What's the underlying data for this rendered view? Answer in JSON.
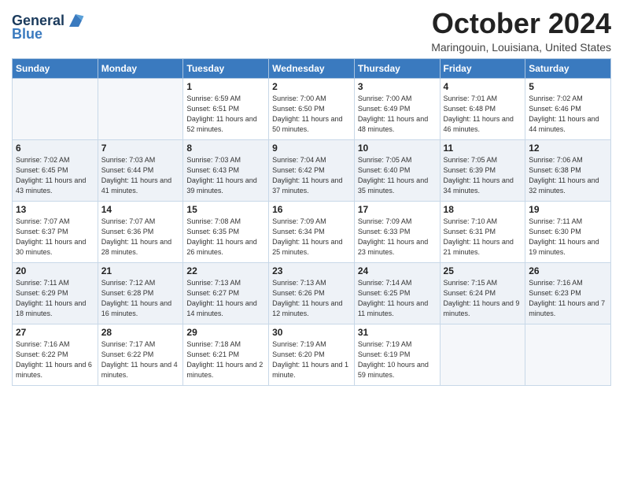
{
  "logo": {
    "line1": "General",
    "line2": "Blue"
  },
  "header": {
    "month": "October 2024",
    "location": "Maringouin, Louisiana, United States"
  },
  "days_of_week": [
    "Sunday",
    "Monday",
    "Tuesday",
    "Wednesday",
    "Thursday",
    "Friday",
    "Saturday"
  ],
  "weeks": [
    [
      {
        "day": "",
        "detail": ""
      },
      {
        "day": "",
        "detail": ""
      },
      {
        "day": "1",
        "detail": "Sunrise: 6:59 AM\nSunset: 6:51 PM\nDaylight: 11 hours\nand 52 minutes."
      },
      {
        "day": "2",
        "detail": "Sunrise: 7:00 AM\nSunset: 6:50 PM\nDaylight: 11 hours\nand 50 minutes."
      },
      {
        "day": "3",
        "detail": "Sunrise: 7:00 AM\nSunset: 6:49 PM\nDaylight: 11 hours\nand 48 minutes."
      },
      {
        "day": "4",
        "detail": "Sunrise: 7:01 AM\nSunset: 6:48 PM\nDaylight: 11 hours\nand 46 minutes."
      },
      {
        "day": "5",
        "detail": "Sunrise: 7:02 AM\nSunset: 6:46 PM\nDaylight: 11 hours\nand 44 minutes."
      }
    ],
    [
      {
        "day": "6",
        "detail": "Sunrise: 7:02 AM\nSunset: 6:45 PM\nDaylight: 11 hours\nand 43 minutes."
      },
      {
        "day": "7",
        "detail": "Sunrise: 7:03 AM\nSunset: 6:44 PM\nDaylight: 11 hours\nand 41 minutes."
      },
      {
        "day": "8",
        "detail": "Sunrise: 7:03 AM\nSunset: 6:43 PM\nDaylight: 11 hours\nand 39 minutes."
      },
      {
        "day": "9",
        "detail": "Sunrise: 7:04 AM\nSunset: 6:42 PM\nDaylight: 11 hours\nand 37 minutes."
      },
      {
        "day": "10",
        "detail": "Sunrise: 7:05 AM\nSunset: 6:40 PM\nDaylight: 11 hours\nand 35 minutes."
      },
      {
        "day": "11",
        "detail": "Sunrise: 7:05 AM\nSunset: 6:39 PM\nDaylight: 11 hours\nand 34 minutes."
      },
      {
        "day": "12",
        "detail": "Sunrise: 7:06 AM\nSunset: 6:38 PM\nDaylight: 11 hours\nand 32 minutes."
      }
    ],
    [
      {
        "day": "13",
        "detail": "Sunrise: 7:07 AM\nSunset: 6:37 PM\nDaylight: 11 hours\nand 30 minutes."
      },
      {
        "day": "14",
        "detail": "Sunrise: 7:07 AM\nSunset: 6:36 PM\nDaylight: 11 hours\nand 28 minutes."
      },
      {
        "day": "15",
        "detail": "Sunrise: 7:08 AM\nSunset: 6:35 PM\nDaylight: 11 hours\nand 26 minutes."
      },
      {
        "day": "16",
        "detail": "Sunrise: 7:09 AM\nSunset: 6:34 PM\nDaylight: 11 hours\nand 25 minutes."
      },
      {
        "day": "17",
        "detail": "Sunrise: 7:09 AM\nSunset: 6:33 PM\nDaylight: 11 hours\nand 23 minutes."
      },
      {
        "day": "18",
        "detail": "Sunrise: 7:10 AM\nSunset: 6:31 PM\nDaylight: 11 hours\nand 21 minutes."
      },
      {
        "day": "19",
        "detail": "Sunrise: 7:11 AM\nSunset: 6:30 PM\nDaylight: 11 hours\nand 19 minutes."
      }
    ],
    [
      {
        "day": "20",
        "detail": "Sunrise: 7:11 AM\nSunset: 6:29 PM\nDaylight: 11 hours\nand 18 minutes."
      },
      {
        "day": "21",
        "detail": "Sunrise: 7:12 AM\nSunset: 6:28 PM\nDaylight: 11 hours\nand 16 minutes."
      },
      {
        "day": "22",
        "detail": "Sunrise: 7:13 AM\nSunset: 6:27 PM\nDaylight: 11 hours\nand 14 minutes."
      },
      {
        "day": "23",
        "detail": "Sunrise: 7:13 AM\nSunset: 6:26 PM\nDaylight: 11 hours\nand 12 minutes."
      },
      {
        "day": "24",
        "detail": "Sunrise: 7:14 AM\nSunset: 6:25 PM\nDaylight: 11 hours\nand 11 minutes."
      },
      {
        "day": "25",
        "detail": "Sunrise: 7:15 AM\nSunset: 6:24 PM\nDaylight: 11 hours\nand 9 minutes."
      },
      {
        "day": "26",
        "detail": "Sunrise: 7:16 AM\nSunset: 6:23 PM\nDaylight: 11 hours\nand 7 minutes."
      }
    ],
    [
      {
        "day": "27",
        "detail": "Sunrise: 7:16 AM\nSunset: 6:22 PM\nDaylight: 11 hours\nand 6 minutes."
      },
      {
        "day": "28",
        "detail": "Sunrise: 7:17 AM\nSunset: 6:22 PM\nDaylight: 11 hours\nand 4 minutes."
      },
      {
        "day": "29",
        "detail": "Sunrise: 7:18 AM\nSunset: 6:21 PM\nDaylight: 11 hours\nand 2 minutes."
      },
      {
        "day": "30",
        "detail": "Sunrise: 7:19 AM\nSunset: 6:20 PM\nDaylight: 11 hours\nand 1 minute."
      },
      {
        "day": "31",
        "detail": "Sunrise: 7:19 AM\nSunset: 6:19 PM\nDaylight: 10 hours\nand 59 minutes."
      },
      {
        "day": "",
        "detail": ""
      },
      {
        "day": "",
        "detail": ""
      }
    ]
  ]
}
